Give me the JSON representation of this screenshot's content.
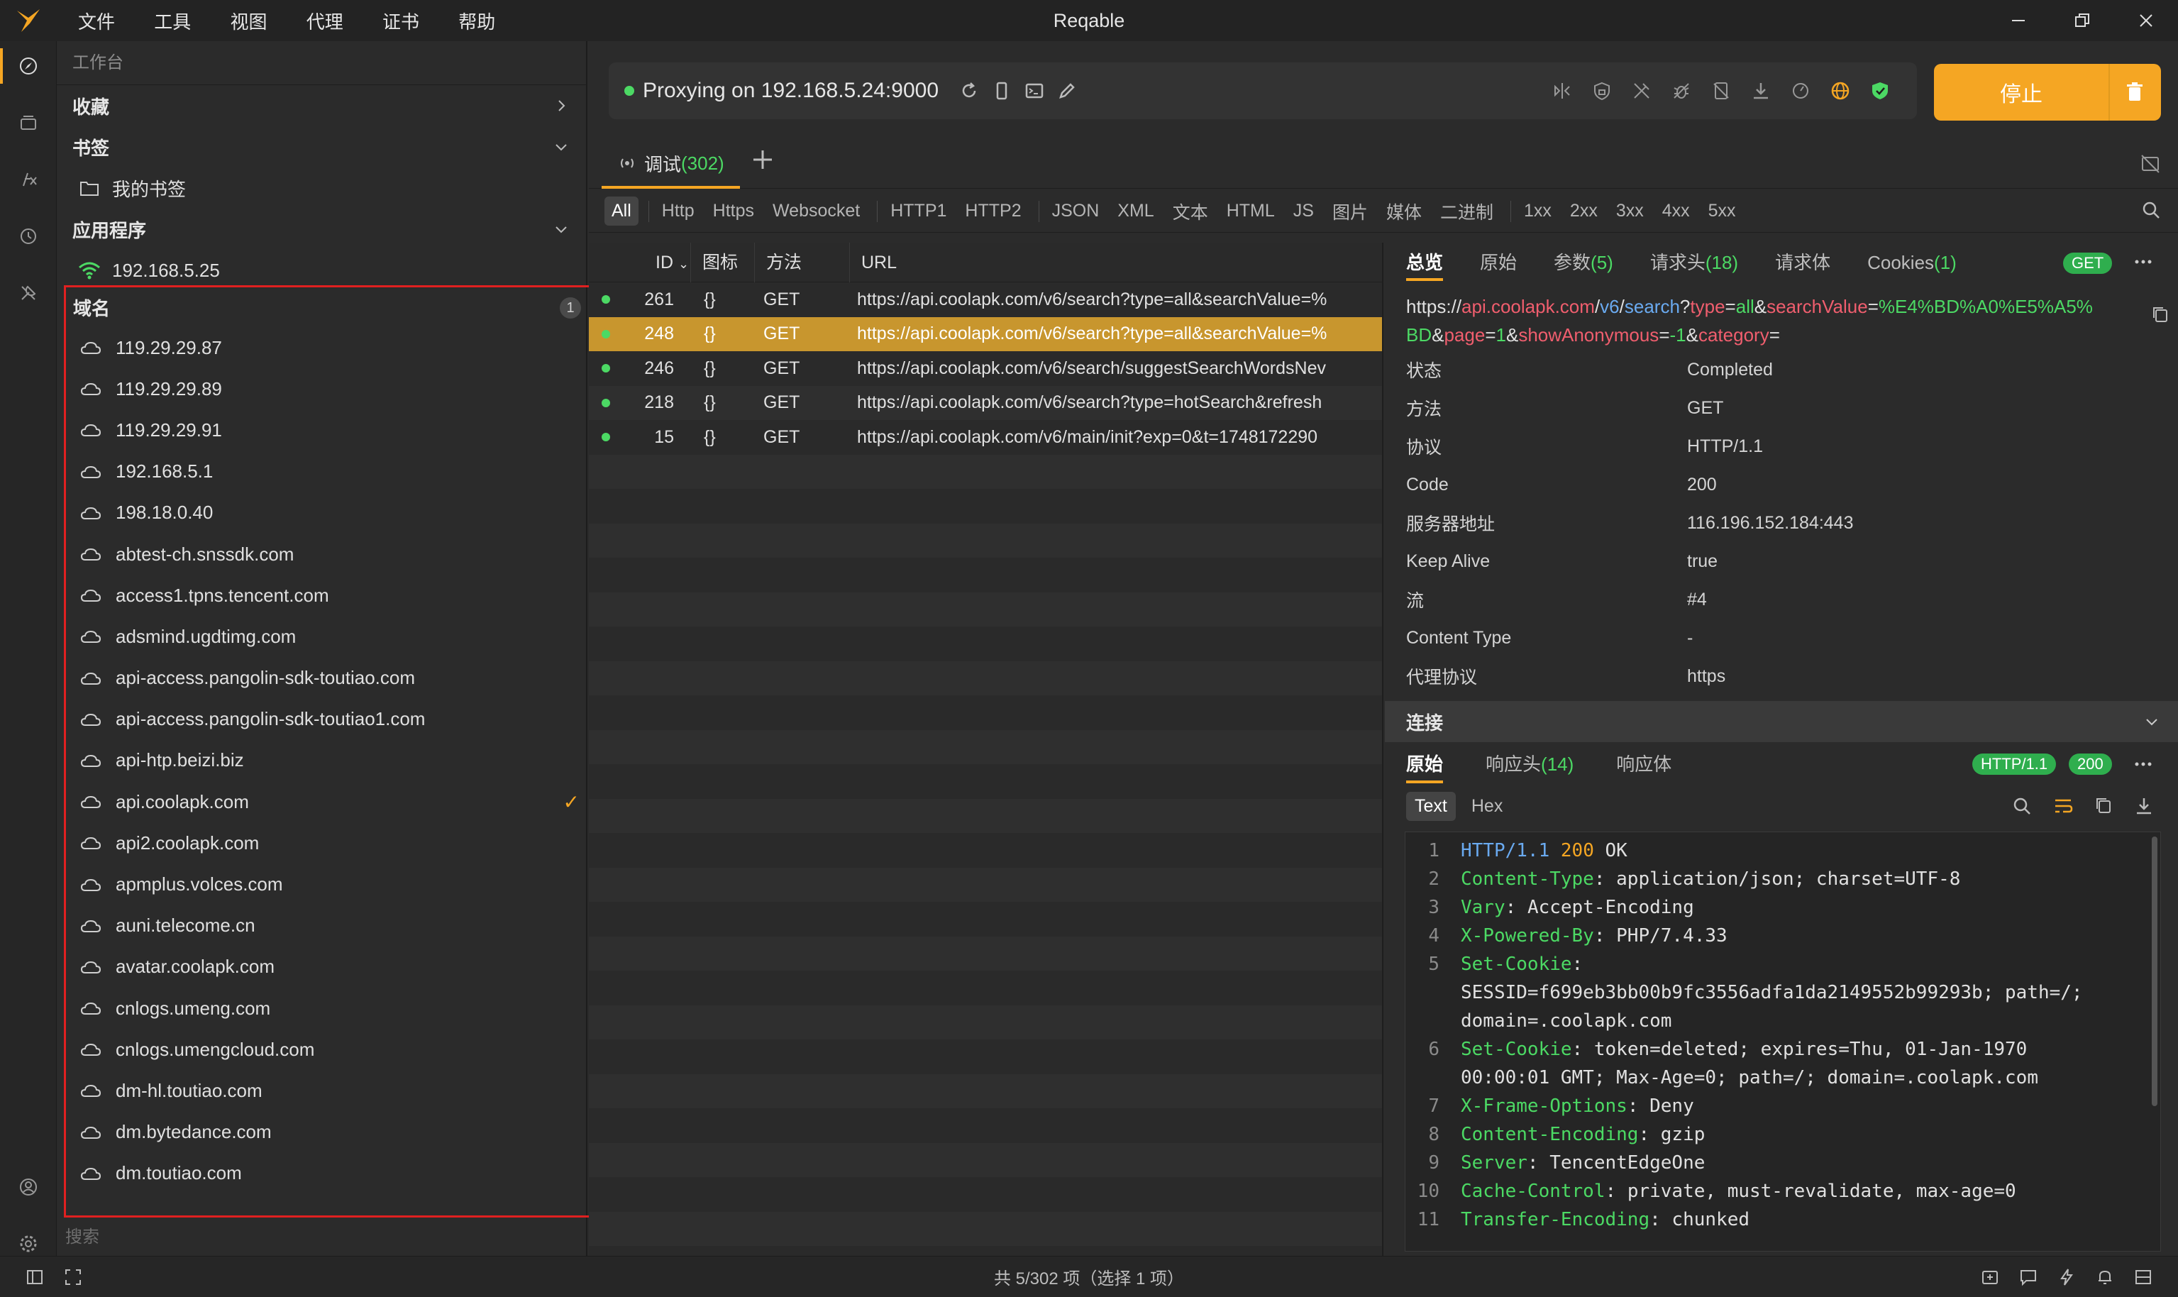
{
  "app": {
    "title": "Reqable",
    "menu": [
      "文件",
      "工具",
      "视图",
      "代理",
      "证书",
      "帮助"
    ]
  },
  "sidebar": {
    "workspace_title": "工作台",
    "favorites_label": "收藏",
    "bookmarks_label": "书签",
    "my_bookmarks_label": "我的书签",
    "apps_label": "应用程序",
    "device_ip": "192.168.5.25",
    "domains_label": "域名",
    "domains_count": "1",
    "domains": [
      "119.29.29.87",
      "119.29.29.89",
      "119.29.29.91",
      "192.168.5.1",
      "198.18.0.40",
      "abtest-ch.snssdk.com",
      "access1.tpns.tencent.com",
      "adsmind.ugdtimg.com",
      "api-access.pangolin-sdk-toutiao.com",
      "api-access.pangolin-sdk-toutiao1.com",
      "api-htp.beizi.biz",
      "api.coolapk.com",
      "api2.coolapk.com",
      "apmplus.volces.com",
      "auni.telecome.cn",
      "avatar.coolapk.com",
      "cnlogs.umeng.com",
      "cnlogs.umengcloud.com",
      "dm-hl.toutiao.com",
      "dm.bytedance.com",
      "dm.toutiao.com"
    ],
    "checked_domain_index": 11,
    "search_placeholder": "搜索"
  },
  "proxy": {
    "status_text": "Proxying on 192.168.5.24:9000",
    "stop_label": "停止"
  },
  "tabs": {
    "debug_label": "调试",
    "debug_count": "(302)"
  },
  "filters": [
    "All",
    "Http",
    "Https",
    "Websocket",
    "HTTP1",
    "HTTP2",
    "JSON",
    "XML",
    "文本",
    "HTML",
    "JS",
    "图片",
    "媒体",
    "二进制",
    "1xx",
    "2xx",
    "3xx",
    "4xx",
    "5xx"
  ],
  "table": {
    "headers": [
      "ID",
      "图标",
      "方法",
      "URL"
    ],
    "rows": [
      {
        "id": "261",
        "icon": "{}",
        "method": "GET",
        "url": "https://api.coolapk.com/v6/search?type=all&searchValue=%"
      },
      {
        "id": "248",
        "icon": "{}",
        "method": "GET",
        "url": "https://api.coolapk.com/v6/search?type=all&searchValue=%"
      },
      {
        "id": "246",
        "icon": "{}",
        "method": "GET",
        "url": "https://api.coolapk.com/v6/search/suggestSearchWordsNev"
      },
      {
        "id": "218",
        "icon": "{}",
        "method": "GET",
        "url": "https://api.coolapk.com/v6/search?type=hotSearch&refresh"
      },
      {
        "id": "15",
        "icon": "{}",
        "method": "GET",
        "url": "https://api.coolapk.com/v6/main/init?exp=0&t=1748172290"
      }
    ],
    "selected_index": 1
  },
  "detail": {
    "tabs": {
      "overview": "总览",
      "raw": "原始",
      "params": "参数",
      "params_count": "(5)",
      "req_headers": "请求头",
      "req_headers_count": "(18)",
      "req_body": "请求体",
      "cookies": "Cookies",
      "cookies_count": "(1)",
      "method_pill": "GET"
    },
    "url": {
      "scheme": "https://",
      "host": "api.coolapk.com",
      "slash1": "/",
      "p1": "v6",
      "slash2": "/",
      "p2": "search",
      "q": "?",
      "k1": "type",
      "eq1": "=",
      "v1": "all",
      "amp1": "&",
      "k2": "searchValue",
      "eq2": "=",
      "v2": "%E4%BD%A0%E5%A5%BD",
      "amp2": "&",
      "k3": "page",
      "eq3": "=",
      "v3": "1",
      "amp3": "&",
      "k4": "showAnonymous",
      "eq4": "=",
      "v4": "-1",
      "amp4": "&",
      "k5": "category",
      "eq5": "="
    },
    "overview": [
      {
        "k": "状态",
        "v": "Completed"
      },
      {
        "k": "方法",
        "v": "GET"
      },
      {
        "k": "协议",
        "v": "HTTP/1.1"
      },
      {
        "k": "Code",
        "v": "200"
      },
      {
        "k": "服务器地址",
        "v": "116.196.152.184:443"
      },
      {
        "k": "Keep Alive",
        "v": "true"
      },
      {
        "k": "流",
        "v": "#4"
      },
      {
        "k": "Content Type",
        "v": "-"
      },
      {
        "k": "代理协议",
        "v": "https"
      }
    ],
    "connection_label": "连接",
    "response_tabs": {
      "raw": "原始",
      "headers": "响应头",
      "headers_count": "(14)",
      "body": "响应体",
      "proto_pill": "HTTP/1.1",
      "code_pill": "200"
    },
    "format_tabs": {
      "text": "Text",
      "hex": "Hex"
    },
    "code_lines": [
      {
        "n": "1",
        "k": "HTTP/1.1",
        "sep": " ",
        "v": "200",
        "rest": " OK",
        "status": true
      },
      {
        "n": "2",
        "k": "Content-Type",
        "sep": ": ",
        "v": "",
        "rest": "application/json; charset=UTF-8"
      },
      {
        "n": "3",
        "k": "Vary",
        "sep": ": ",
        "v": "",
        "rest": "Accept-Encoding"
      },
      {
        "n": "4",
        "k": "X-Powered-By",
        "sep": ": ",
        "v": "",
        "rest": "PHP/7.4.33"
      },
      {
        "n": "5",
        "k": "Set-Cookie",
        "sep": ":",
        "v": "",
        "rest": "\nSESSID=f699eb3bb00b9fc3556adfa1da2149552b99293b; path=/;\ndomain=.coolapk.com"
      },
      {
        "n": "6",
        "k": "Set-Cookie",
        "sep": ": ",
        "v": "",
        "rest": "token=deleted; expires=Thu, 01-Jan-1970\n00:00:01 GMT; Max-Age=0; path=/; domain=.coolapk.com"
      },
      {
        "n": "7",
        "k": "X-Frame-Options",
        "sep": ": ",
        "v": "",
        "rest": "Deny"
      },
      {
        "n": "8",
        "k": "Content-Encoding",
        "sep": ": ",
        "v": "",
        "rest": "gzip"
      },
      {
        "n": "9",
        "k": "Server",
        "sep": ": ",
        "v": "",
        "rest": "TencentEdgeOne"
      },
      {
        "n": "10",
        "k": "Cache-Control",
        "sep": ": ",
        "v": "",
        "rest": "private, must-revalidate, max-age=0"
      },
      {
        "n": "11",
        "k": "Transfer-Encoding",
        "sep": ": ",
        "v": "",
        "rest": "chunked"
      }
    ]
  },
  "statusbar": {
    "text": "共 5/302 项（选择 1 项）"
  },
  "colors": {
    "accent": "#f5a623",
    "success": "#4cd964",
    "highlight_border": "#e02020"
  }
}
